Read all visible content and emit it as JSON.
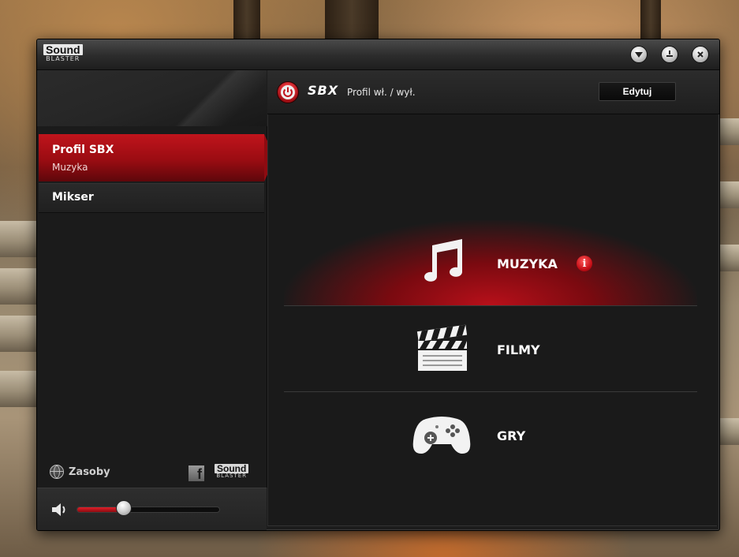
{
  "window": {
    "logo_top": "Sound",
    "logo_bottom": "BLASTER",
    "controls": {
      "menu_icon": "chevron-down-icon",
      "minimize_icon": "minimize-icon",
      "close_icon": "close-icon"
    }
  },
  "sidebar": {
    "items": [
      {
        "label": "Profil SBX",
        "sub": "Muzyka",
        "active": true
      },
      {
        "label": "Mikser",
        "sub": "",
        "active": false
      }
    ],
    "footer": {
      "resources_label": "Zasoby",
      "facebook_glyph": "f",
      "logo_top": "Sound",
      "logo_bottom": "BLASTER"
    },
    "volume": {
      "level": 0.33
    }
  },
  "header": {
    "title": "SBX",
    "toggle_label": "Profil wł. / wył.",
    "edit_label": "Edytuj"
  },
  "categories": [
    {
      "label": "MUZYKA",
      "icon": "music-note-icon",
      "active": true,
      "badge": "i"
    },
    {
      "label": "FILMY",
      "icon": "clapperboard-icon",
      "active": false
    },
    {
      "label": "GRY",
      "icon": "gamepad-icon",
      "active": false
    }
  ],
  "colors": {
    "accent": "#c0141c",
    "background": "#1c1c1c"
  }
}
